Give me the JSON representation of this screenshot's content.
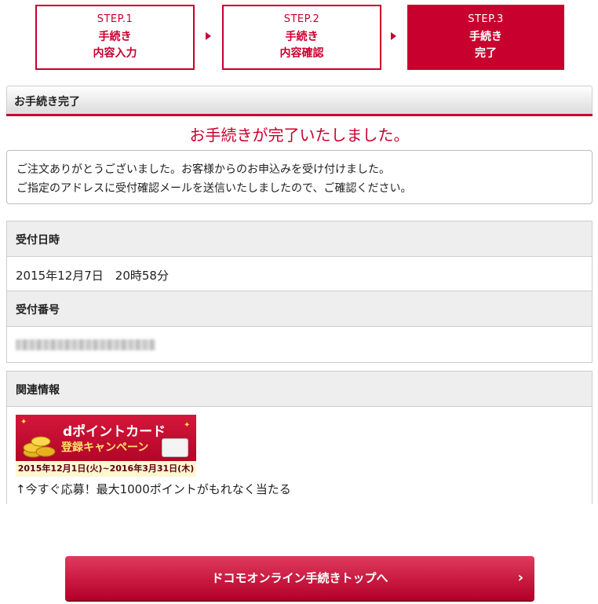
{
  "steps": [
    {
      "num": "STEP.1",
      "label": "手続き\n内容入力"
    },
    {
      "num": "STEP.2",
      "label": "手続き\n内容確認"
    },
    {
      "num": "STEP.3",
      "label": "手続き\n完了"
    }
  ],
  "section_title": "お手続き完了",
  "completion_message": "お手続きが完了いたしました。",
  "thanks_lines": [
    "ご注文ありがとうございました。お客様からのお申込みを受け付けました。",
    "ご指定のアドレスに受付確認メールを送信いたしましたので、ご確認ください。"
  ],
  "reception": {
    "date_label": "受付日時",
    "date_value": "2015年12月7日　20時58分",
    "number_label": "受付番号"
  },
  "related": {
    "label": "関連情報",
    "banner": {
      "title": "dポイントカード",
      "subtitle": "登録キャンペーン",
      "period": "2015年12月1日(火)~2016年3月31日(木)"
    },
    "caption": "↑今すぐ応募！最大1000ポイントがもれなく当たる"
  },
  "cta": {
    "label": "ドコモオンライン手続きトップへ",
    "chevron": "›"
  },
  "colors": {
    "accent": "#c8002e"
  }
}
